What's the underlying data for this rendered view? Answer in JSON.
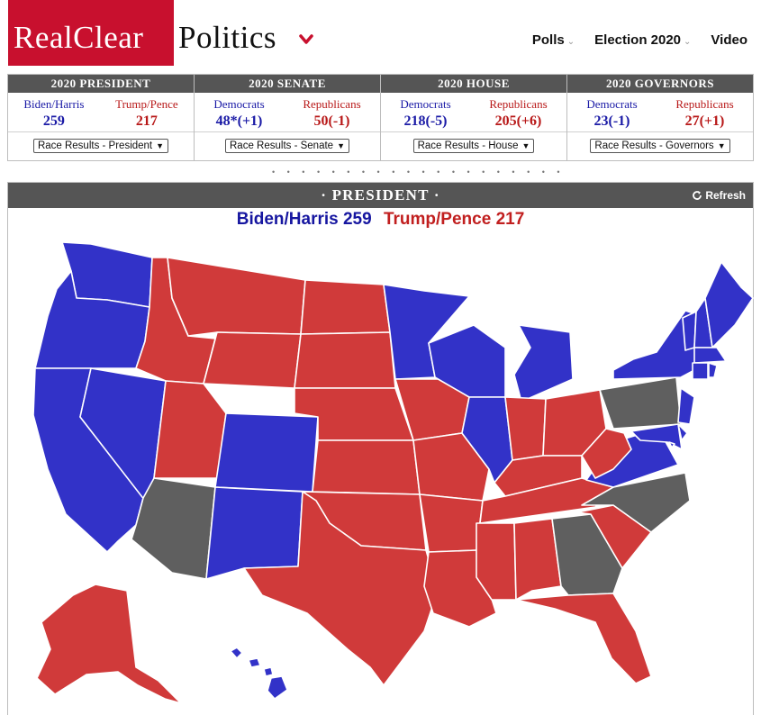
{
  "header": {
    "logo_part1": "RealClear",
    "logo_part2": "Politics",
    "nav": [
      {
        "label": "Polls",
        "has_dropdown": true
      },
      {
        "label": "Election 2020",
        "has_dropdown": true
      },
      {
        "label": "Video",
        "has_dropdown": false
      }
    ]
  },
  "results": [
    {
      "title": "2020 PRESIDENT",
      "left_label": "Biden/Harris",
      "left_value": "259",
      "right_label": "Trump/Pence",
      "right_value": "217",
      "select": "Race Results - President"
    },
    {
      "title": "2020 SENATE",
      "left_label": "Democrats",
      "left_value": "48*(+1)",
      "right_label": "Republicans",
      "right_value": "50(-1)",
      "select": "Race Results - Senate"
    },
    {
      "title": "2020 HOUSE",
      "left_label": "Democrats",
      "left_value": "218(-5)",
      "right_label": "Republicans",
      "right_value": "205(+6)",
      "select": "Race Results - House"
    },
    {
      "title": "2020 GOVERNORS",
      "left_label": "Democrats",
      "left_value": "23(-1)",
      "right_label": "Republicans",
      "right_value": "27(+1)",
      "select": "Race Results - Governors"
    }
  ],
  "panel": {
    "title": "· PRESIDENT ·",
    "refresh_label": "Refresh",
    "biden_tally": "Biden/Harris 259",
    "trump_tally": "Trump/Pence 217"
  },
  "map": {
    "colors": {
      "dem": "#3232c8",
      "rep": "#d03a3a",
      "undecided": "#5f5f5f",
      "border": "#ffffff"
    },
    "states": {
      "WA": "dem",
      "OR": "dem",
      "CA": "dem",
      "NV": "dem",
      "CO": "dem",
      "NM": "dem",
      "MN": "dem",
      "WI": "dem",
      "MI": "dem",
      "IL": "dem",
      "VA": "dem",
      "NY": "dem",
      "NJ": "dem",
      "DE": "dem",
      "MD": "dem",
      "DC": "dem",
      "CT": "dem",
      "RI": "dem",
      "MA": "dem",
      "VT": "dem",
      "NH": "dem",
      "ME": "dem",
      "HI": "dem",
      "ID": "rep",
      "MT": "rep",
      "WY": "rep",
      "UT": "rep",
      "ND": "rep",
      "SD": "rep",
      "NE": "rep",
      "KS": "rep",
      "OK": "rep",
      "TX": "rep",
      "IA": "rep",
      "MO": "rep",
      "AR": "rep",
      "LA": "rep",
      "MS": "rep",
      "AL": "rep",
      "TN": "rep",
      "KY": "rep",
      "IN": "rep",
      "OH": "rep",
      "WV": "rep",
      "SC": "rep",
      "FL": "rep",
      "AK": "rep",
      "AZ": "undecided",
      "GA": "undecided",
      "NC": "undecided",
      "PA": "undecided"
    }
  }
}
